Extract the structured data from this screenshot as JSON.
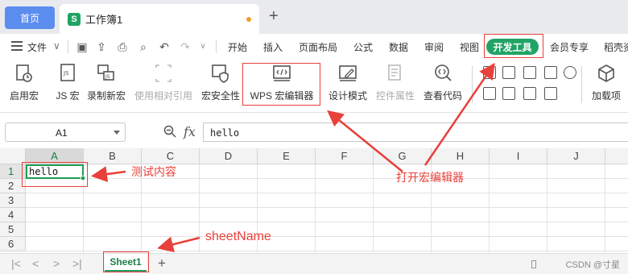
{
  "tabs": {
    "home": "首页",
    "doc_icon_glyph": "S",
    "doc_title": "工作簿1",
    "add": "+"
  },
  "menu": {
    "file": "文件",
    "items": [
      "开始",
      "插入",
      "页面布局",
      "公式",
      "数据",
      "审阅",
      "视图"
    ],
    "active": "开发工具",
    "after": [
      "会员专享",
      "稻壳资"
    ]
  },
  "ribbon": {
    "enable_macro": "启用宏",
    "js_macro": "JS 宏",
    "record_macro": "录制新宏",
    "relative_ref": "使用相对引用",
    "macro_security": "宏安全性",
    "wps_macro_editor": "WPS 宏编辑器",
    "design_mode": "设计模式",
    "control_props": "控件属性",
    "view_code": "查看代码",
    "addins": "加载项"
  },
  "formula_bar": {
    "name_box": "A1",
    "fx": "fx",
    "value": "hello"
  },
  "grid": {
    "columns": [
      "A",
      "B",
      "C",
      "D",
      "E",
      "F",
      "G",
      "H",
      "I",
      "J"
    ],
    "rows": [
      "1",
      "2",
      "3",
      "4",
      "5",
      "6"
    ],
    "a1_value": "hello"
  },
  "sheets": {
    "nav": [
      "|<",
      "<",
      ">",
      ">|"
    ],
    "active": "Sheet1",
    "add": "+"
  },
  "watermark": "CSDN @寸星",
  "annotations": {
    "test_content": "测试内容",
    "open_editor": "打开宏编辑器",
    "sheet_name": "sheetName"
  },
  "colors": {
    "accent_green": "#21a366",
    "home_blue": "#5b8def",
    "annotation_red": "#e8403a"
  }
}
